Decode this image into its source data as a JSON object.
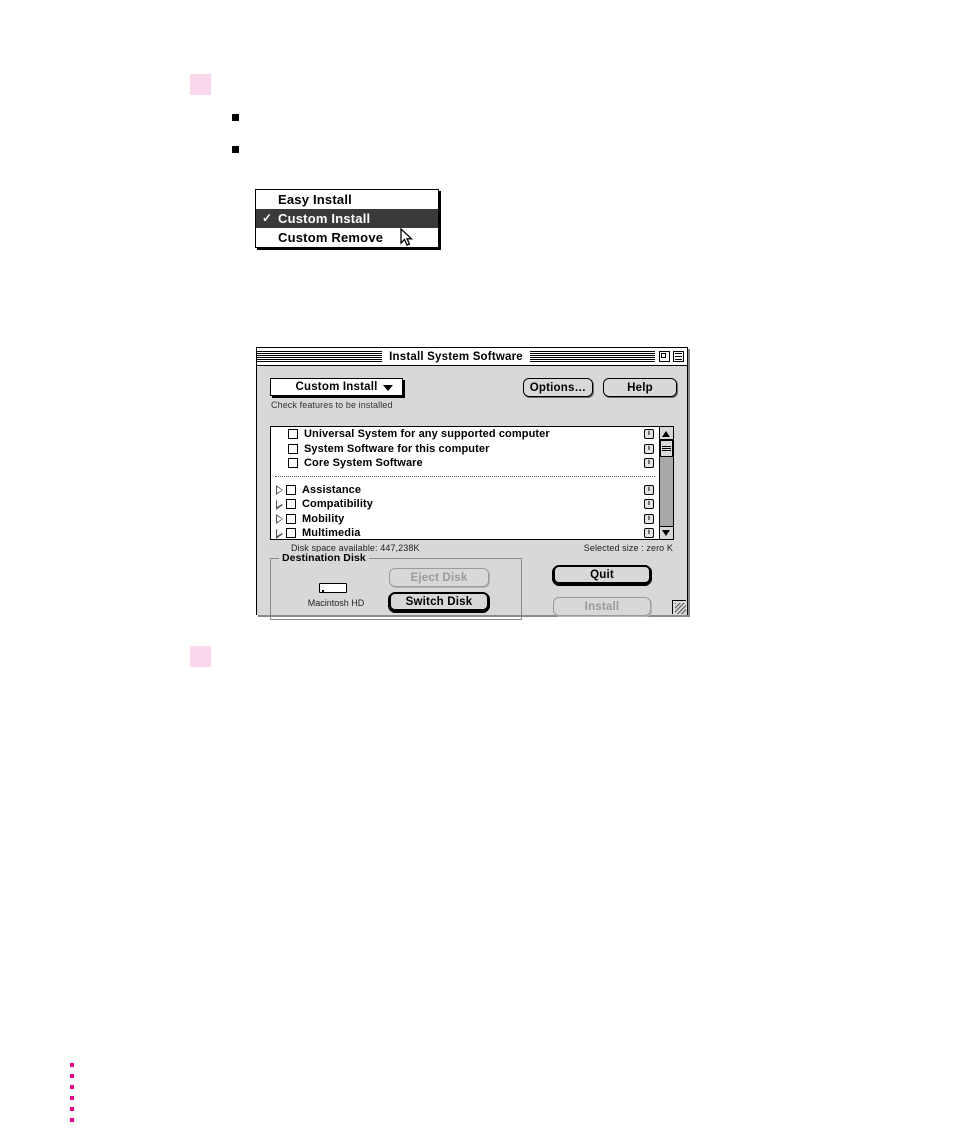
{
  "popup_menu": {
    "items": [
      {
        "label": "Easy Install",
        "checked": false,
        "selected": false
      },
      {
        "label": "Custom Install",
        "checked": true,
        "selected": true
      },
      {
        "label": "Custom Remove",
        "checked": false,
        "selected": false
      }
    ],
    "check_glyph": "✓",
    "cursor": "arrow-pointer"
  },
  "window": {
    "title": "Install System Software",
    "widgets": {
      "zoom_box": "zoom-box",
      "collapse_box": "collapse-box"
    },
    "popup": {
      "value": "Custom Install",
      "arrow": "chevron-down-icon"
    },
    "options_label": "Options…",
    "help_label": "Help",
    "hint": "Check features to be installed",
    "features": {
      "top": [
        {
          "label": "Universal System for any supported computer",
          "checked": false,
          "has_triangle": false,
          "info": "i"
        },
        {
          "label": "System Software for this computer",
          "checked": false,
          "has_triangle": false,
          "info": "i"
        },
        {
          "label": "Core System Software",
          "checked": false,
          "has_triangle": false,
          "info": "i"
        }
      ],
      "groups": [
        {
          "label": "Assistance",
          "checked": false,
          "has_triangle": true,
          "info": "i"
        },
        {
          "label": "Compatibility",
          "checked": false,
          "has_triangle": true,
          "info": "i"
        },
        {
          "label": "Mobility",
          "checked": false,
          "has_triangle": true,
          "info": "i"
        },
        {
          "label": "Multimedia",
          "checked": false,
          "has_triangle": true,
          "info": "i"
        }
      ]
    },
    "scrollbar": {
      "up_arrow": "triangle-up-icon",
      "down_arrow": "triangle-down-icon",
      "thumb": "scroll-thumb"
    },
    "status": {
      "disk_space": "Disk space available: 447,238K",
      "selected_size": "Selected size : zero K"
    },
    "destination": {
      "legend": "Destination Disk",
      "disk_name": "Macintosh HD",
      "eject_label": "Eject Disk",
      "eject_enabled": false,
      "switch_label": "Switch Disk",
      "switch_enabled": true
    },
    "quit_label": "Quit",
    "quit_enabled": true,
    "install_label": "Install",
    "install_enabled": false,
    "resize_grip": "resize-grip-icon"
  },
  "page_markers": {
    "pink_square_color": "#fad8ec",
    "bullet_color": "#000000",
    "dot_color": "#ec008c",
    "dot_count": 6
  }
}
